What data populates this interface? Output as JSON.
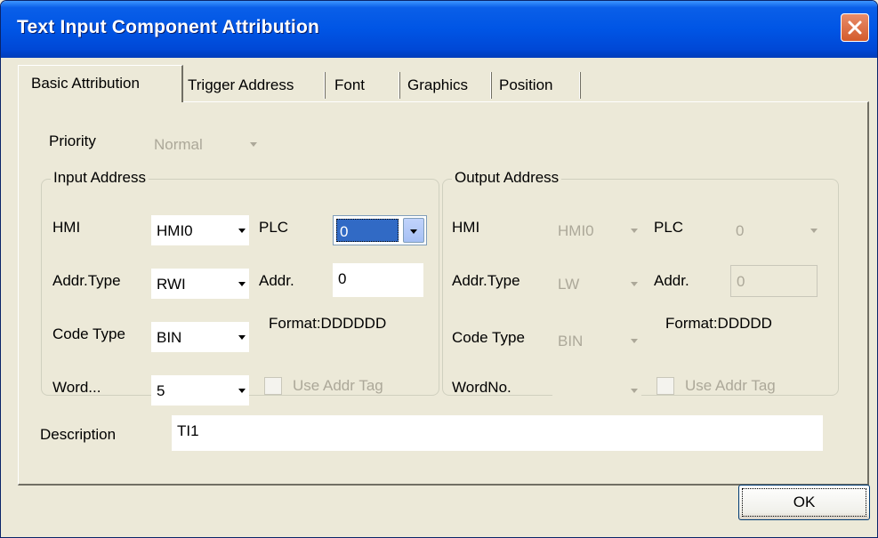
{
  "window": {
    "title": "Text Input Component Attribution"
  },
  "tabs": [
    {
      "label": "Basic Attribution",
      "active": true
    },
    {
      "label": "Trigger Address",
      "active": false
    },
    {
      "label": "Font",
      "active": false
    },
    {
      "label": "Graphics",
      "active": false
    },
    {
      "label": "Position",
      "active": false
    }
  ],
  "priority": {
    "label": "Priority",
    "value": "Normal"
  },
  "input_address": {
    "title": "Input Address",
    "hmi_label": "HMI",
    "hmi_value": "HMI0",
    "plc_label": "PLC",
    "plc_value": "0",
    "addr_type_label": "Addr.Type",
    "addr_type_value": "RWI",
    "addr_label": "Addr.",
    "addr_value": "0",
    "code_type_label": "Code Type",
    "code_type_value": "BIN",
    "format_text": "Format:DDDDDD",
    "word_label": "Word...",
    "word_value": "5",
    "use_addr_tag_label": "Use Addr Tag"
  },
  "output_address": {
    "title": "Output Address",
    "hmi_label": "HMI",
    "hmi_value": "HMI0",
    "plc_label": "PLC",
    "plc_value": "0",
    "addr_type_label": "Addr.Type",
    "addr_type_value": "LW",
    "addr_label": "Addr.",
    "addr_value": "0",
    "code_type_label": "Code Type",
    "code_type_value": "BIN",
    "format_text": "Format:DDDDD",
    "word_label": "WordNo.",
    "word_value": "",
    "use_addr_tag_label": "Use Addr Tag"
  },
  "description": {
    "label": "Description",
    "value": "TI1"
  },
  "ok_button": {
    "label": "OK"
  },
  "colors": {
    "title_bar": "#0055E5",
    "dialog_bg": "#ECE9D8",
    "selection": "#316AC5",
    "close_button": "#D35B2B"
  }
}
